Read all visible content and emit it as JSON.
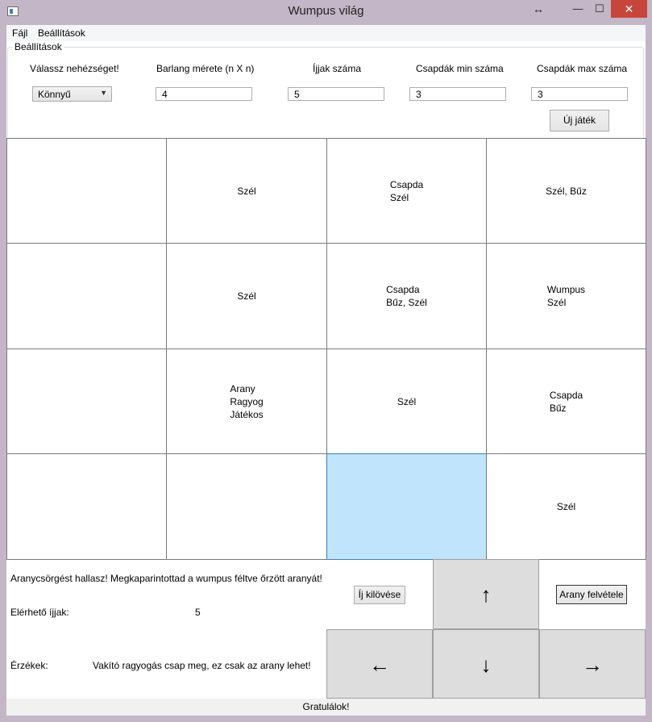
{
  "window": {
    "title": "Wumpus világ"
  },
  "menu": {
    "items": [
      "Fájl",
      "Beállítások"
    ]
  },
  "settings": {
    "group_title": "Beállítások",
    "difficulty_label": "Válassz nehézséget!",
    "difficulty_value": "Könnyű",
    "cave_size_label": "Barlang mérete (n X n)",
    "cave_size_value": "4",
    "arrows_label": "Íjjak száma",
    "arrows_value": "5",
    "traps_min_label": "Csapdák min száma",
    "traps_min_value": "3",
    "traps_max_label": "Csapdák max száma",
    "traps_max_value": "3",
    "new_game_label": "Új játék"
  },
  "grid": {
    "size": 4,
    "player_cell": [
      3,
      2
    ],
    "cells": [
      [
        [],
        [
          "Szél"
        ],
        [
          "Csapda",
          "Szél"
        ],
        [
          "Szél, Bűz"
        ]
      ],
      [
        [],
        [
          "Szél"
        ],
        [
          "Csapda",
          "Bűz, Szél"
        ],
        [
          "Wumpus",
          "Szél"
        ]
      ],
      [
        [],
        [
          "Arany",
          "Ragyog",
          "Játékos"
        ],
        [
          "Szél"
        ],
        [
          "Csapda",
          "Bűz"
        ]
      ],
      [
        [],
        [],
        [],
        [
          "Szél"
        ]
      ]
    ]
  },
  "info": {
    "message": "Aranycsörgést hallasz! Megkaparintottad a wumpus féltve őrzött aranyát!",
    "arrows_label": "Elérhető íjjak:",
    "arrows_value": "5",
    "senses_label": "Érzékek:",
    "senses_value": "Vakító ragyogás csap meg, ez csak az arany lehet!"
  },
  "controls": {
    "shoot_label": "Íj kilövése",
    "pickup_label": "Arany felvétele",
    "up": "↑",
    "down": "↓",
    "left": "←",
    "right": "→"
  },
  "status": {
    "text": "Gratulálok!"
  },
  "colors": {
    "player_cell": "#c0e4fb",
    "close_button": "#c7463b"
  }
}
